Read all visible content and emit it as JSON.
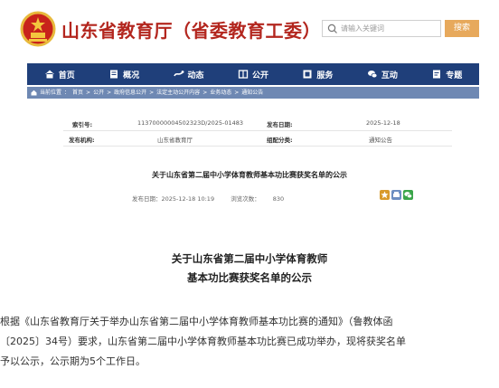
{
  "header": {
    "site_title": "山东省教育厅（省委教育工委）",
    "search_placeholder": "请输入关键词",
    "search_button": "搜索"
  },
  "nav": {
    "items": [
      {
        "label": "首页",
        "icon": "home-icon"
      },
      {
        "label": "概况",
        "icon": "overview-icon"
      },
      {
        "label": "动态",
        "icon": "news-icon"
      },
      {
        "label": "公开",
        "icon": "disclosure-icon"
      },
      {
        "label": "服务",
        "icon": "service-icon"
      },
      {
        "label": "互动",
        "icon": "interaction-icon"
      },
      {
        "label": "专题",
        "icon": "topics-icon"
      }
    ]
  },
  "breadcrumb": {
    "items": [
      "当前位置",
      "首页",
      "公开",
      "政府信息公开",
      "法定主动公开内容",
      "业务动态",
      "通知公告"
    ]
  },
  "info": {
    "index_label": "索引号:",
    "index_value": "11370000004502323D/2025-01483",
    "date_label": "发布日期:",
    "date_value": "2025-12-18",
    "org_label": "发布机构:",
    "org_value": "山东省教育厅",
    "category_label": "组配分类:",
    "category_value": "通知公告"
  },
  "article": {
    "heading": "关于山东省第二届中小学体育教师基本功比赛获奖名单的公示",
    "publish_label": "发布日期：",
    "publish_time": "2025-12-18 10:19",
    "views_label": "浏览次数：",
    "views_value": "830",
    "title_line1": "关于山东省第二届中小学体育教师",
    "title_line2": "基本功比赛获奖名单的公示",
    "body_line1": "根据《山东省教育厅关于举办山东省第二届中小学体育教师基本功比赛的通知》（鲁教体函",
    "body_line2": "〔2025〕34号）要求，山东省第二届中小学体育教师基本功比赛已成功举办，现将获奖名单",
    "body_line3": "予以公示，公示期为5个工作日。"
  },
  "colors": {
    "title_red": "#b3261e",
    "nav_blue": "#1f3f7a",
    "crumb_blue": "#6e88b3",
    "search_orange": "#e7a95c"
  }
}
